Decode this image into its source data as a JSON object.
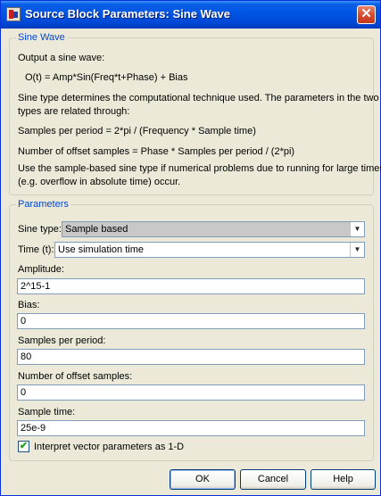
{
  "window": {
    "title": "Source Block Parameters: Sine Wave",
    "close_glyph": "✕"
  },
  "description": {
    "group_title": "Sine Wave",
    "lines": [
      "Output a sine wave:",
      "O(t) = Amp*Sin(Freq*t+Phase) + Bias",
      "Sine type determines the computational technique used. The parameters in the two",
      "types are related through:",
      "Samples per period = 2*pi / (Frequency * Sample time)",
      "Number of offset samples = Phase * Samples per period / (2*pi)",
      "Use the sample-based sine type if numerical problems due to running for large times",
      "(e.g. overflow in absolute time) occur."
    ]
  },
  "parameters": {
    "group_title": "Parameters",
    "sine_type": {
      "label": "Sine type:",
      "value": "Sample based"
    },
    "time": {
      "label": "Time (t):",
      "value": "Use simulation time"
    },
    "amplitude": {
      "label": "Amplitude:",
      "value": "2^15-1"
    },
    "bias": {
      "label": "Bias:",
      "value": "0"
    },
    "samples_per_period": {
      "label": "Samples per period:",
      "value": "80"
    },
    "offset_samples": {
      "label": "Number of offset samples:",
      "value": "0"
    },
    "sample_time": {
      "label": "Sample time:",
      "value": "25e-9"
    },
    "interpret_vector": {
      "label": "Interpret vector parameters as 1-D",
      "checked": true,
      "check_glyph": "✔"
    }
  },
  "buttons": {
    "ok": "OK",
    "cancel": "Cancel",
    "help": "Help"
  },
  "colors": {
    "titlebar": "#0054e3",
    "group_title": "#0046d5",
    "dialog_bg": "#ece9d8",
    "selected_dropdown_bg": "#c8c8c8"
  },
  "icons": {
    "window": "simulink-block-icon",
    "dropdown": "chevron-down-icon",
    "close": "close-icon",
    "check": "checkmark-icon"
  }
}
